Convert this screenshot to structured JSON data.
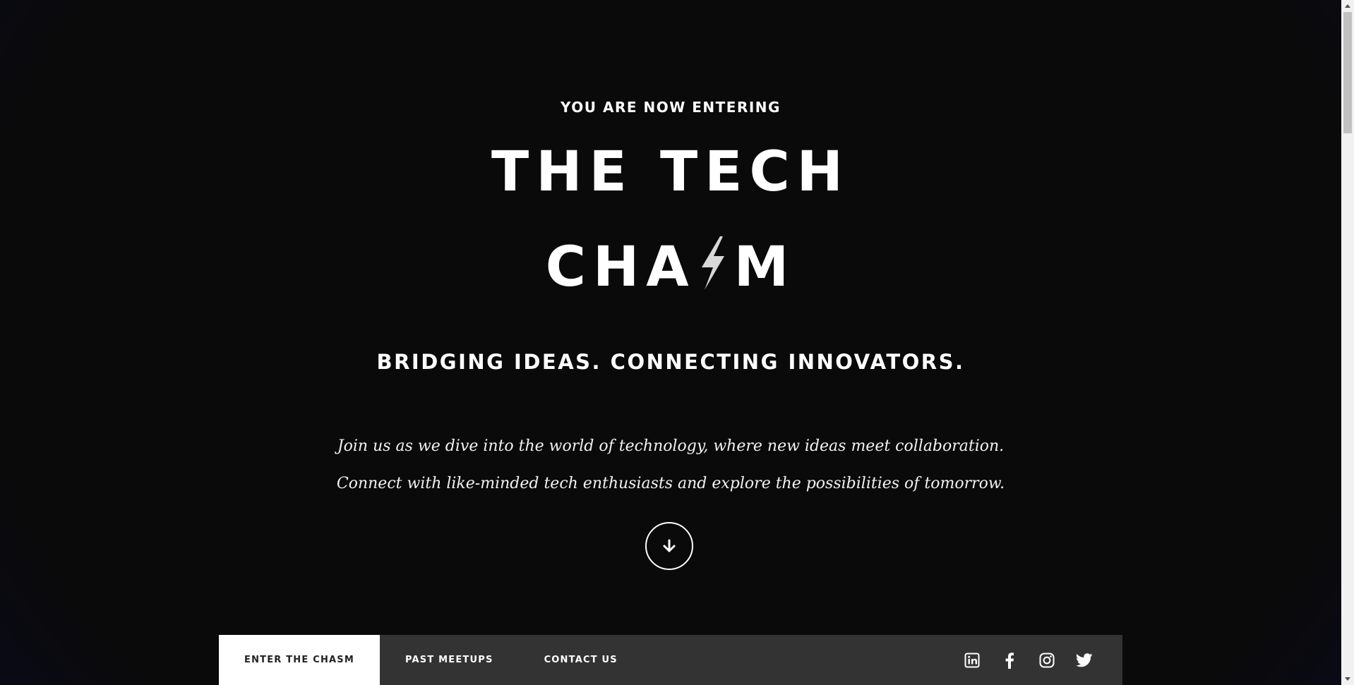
{
  "hero": {
    "kicker": "YOU ARE NOW ENTERING",
    "title_line1": "THE TECH",
    "title_line2_prefix": "CHA",
    "title_line2_suffix": "M",
    "tagline": "BRIDGING IDEAS. CONNECTING INNOVATORS.",
    "description": [
      "Join us as we dive into the world of technology, where new ideas meet collaboration.",
      "Connect with like-minded tech enthusiasts and explore the possibilities of tomorrow."
    ],
    "scroll_icon": "arrow-down-icon"
  },
  "nav": {
    "items": [
      {
        "label": "ENTER THE CHASM",
        "active": true
      },
      {
        "label": "PAST MEETUPS",
        "active": false
      },
      {
        "label": "CONTACT US",
        "active": false
      }
    ],
    "social": [
      "linkedin-icon",
      "facebook-icon",
      "instagram-icon",
      "twitter-icon"
    ]
  },
  "colors": {
    "background": "#0a0a0a",
    "edge_glow": "#03105a",
    "navbar": "#333333",
    "active_nav": "#ffffff",
    "text": "#ffffff"
  }
}
